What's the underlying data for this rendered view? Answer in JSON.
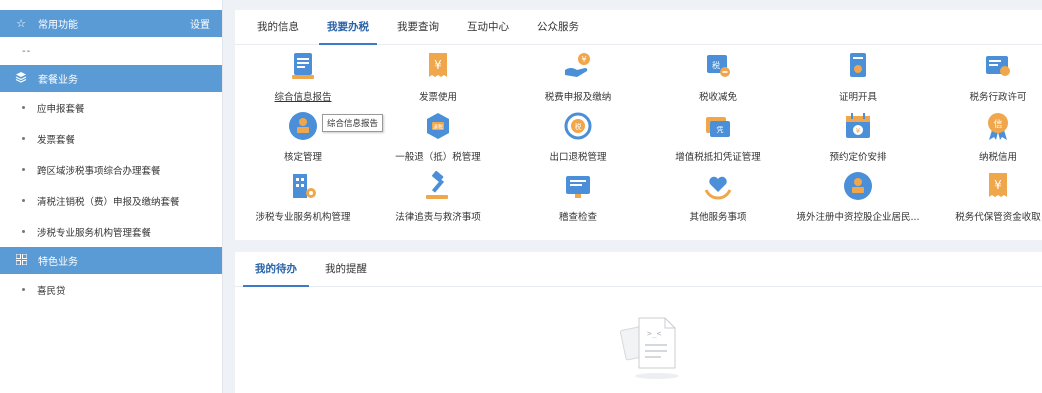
{
  "sidebar": {
    "common": {
      "title": "常用功能",
      "settings": "设置",
      "placeholder": "--"
    },
    "package": {
      "title": "套餐业务",
      "items": [
        "应申报套餐",
        "发票套餐",
        "跨区域涉税事项综合办理套餐",
        "清税注销税（费）申报及缴纳套餐",
        "涉税专业服务机构管理套餐"
      ]
    },
    "special": {
      "title": "特色业务",
      "items": [
        "喜民贷"
      ]
    }
  },
  "tabs": [
    "我的信息",
    "我要办税",
    "我要查询",
    "互动中心",
    "公众服务"
  ],
  "active_tab": "我要办税",
  "services": [
    {
      "label": "综合信息报告",
      "icon": "report-icon"
    },
    {
      "label": "发票使用",
      "icon": "invoice-icon"
    },
    {
      "label": "税费申报及缴纳",
      "icon": "tax-payment-icon"
    },
    {
      "label": "税收减免",
      "icon": "tax-relief-icon"
    },
    {
      "label": "证明开具",
      "icon": "certificate-icon"
    },
    {
      "label": "税务行政许可",
      "icon": "admin-license-icon"
    },
    {
      "label": "核定管理",
      "icon": "approval-stamp-icon"
    },
    {
      "label": "一般退（抵）税管理",
      "icon": "refund-icon"
    },
    {
      "label": "出口退税管理",
      "icon": "export-refund-icon"
    },
    {
      "label": "增值税抵扣凭证管理",
      "icon": "vat-voucher-icon"
    },
    {
      "label": "预约定价安排",
      "icon": "calendar-icon"
    },
    {
      "label": "纳税信用",
      "icon": "credit-medal-icon"
    },
    {
      "label": "涉税专业服务机构管理",
      "icon": "building-gear-icon"
    },
    {
      "label": "法律追责与救济事项",
      "icon": "gavel-icon"
    },
    {
      "label": "稽查检查",
      "icon": "inspection-icon"
    },
    {
      "label": "其他服务事项",
      "icon": "heart-hand-icon"
    },
    {
      "label": "境外注册中资控股企业居民...",
      "icon": "overseas-stamp-icon"
    },
    {
      "label": "税务代保管资金收取",
      "icon": "custody-fund-icon"
    }
  ],
  "tooltip": "综合信息报告",
  "bottom_tabs": [
    "我的待办",
    "我的提醒"
  ],
  "active_bottom_tab": "我的待办",
  "colors": {
    "primary": "#5b9bd5",
    "accent": "#3d7ac8",
    "icon_orange": "#f0a64a",
    "icon_blue": "#4a8fd8"
  }
}
